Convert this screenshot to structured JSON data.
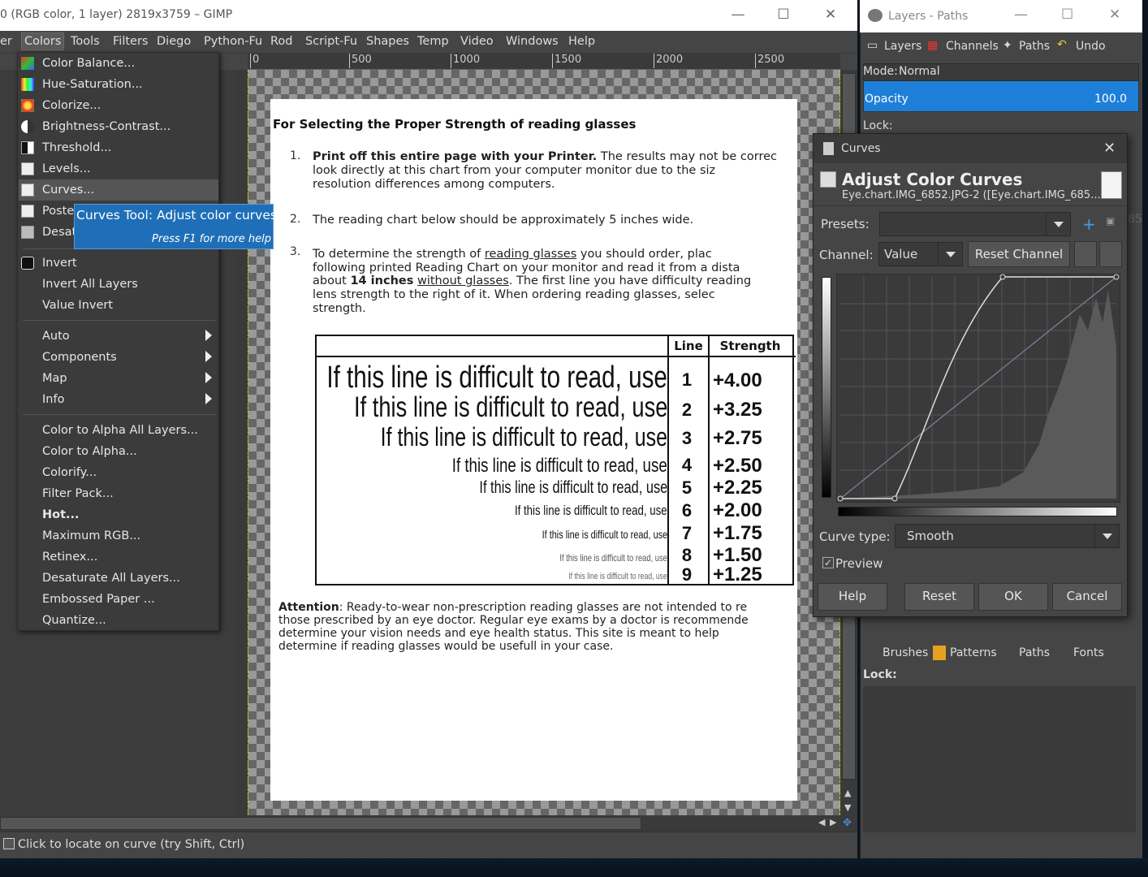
{
  "main_window": {
    "title": "0 (RGB color, 1 layer) 2819x3759 – GIMP",
    "menus": [
      "er",
      "Colors",
      "Tools",
      "Filters",
      "Diego",
      "Python-Fu",
      "Rod",
      "Script-Fu",
      "Shapes",
      "Temp",
      "Video",
      "Windows",
      "Help"
    ],
    "ruler_labels": [
      "0",
      "500",
      "1000",
      "1500",
      "2000",
      "2500"
    ],
    "status": "Click to locate on curve (try Shift, Ctrl)"
  },
  "colors_menu": {
    "items": [
      {
        "label": "Color Balance...",
        "icon": "color-balance-icon"
      },
      {
        "label": "Hue-Saturation...",
        "icon": "hue-saturation-icon"
      },
      {
        "label": "Colorize...",
        "icon": "colorize-icon"
      },
      {
        "label": "Brightness-Contrast...",
        "icon": "brightness-contrast-icon"
      },
      {
        "label": "Threshold...",
        "icon": "threshold-icon"
      },
      {
        "label": "Levels...",
        "icon": "levels-icon"
      },
      {
        "label": "Curves...",
        "icon": "curves-icon"
      },
      {
        "label": "Poster",
        "icon": "posterize-icon"
      },
      {
        "label": "Desat",
        "icon": "desaturate-icon"
      }
    ],
    "group2": [
      {
        "label": "Invert",
        "icon": "invert-icon"
      },
      {
        "label": "Invert All Layers"
      },
      {
        "label": "Value Invert"
      }
    ],
    "submenus": [
      "Auto",
      "Components",
      "Map",
      "Info"
    ],
    "group4": [
      "Color to Alpha All Layers...",
      "Color to Alpha...",
      "Colorify...",
      "Filter Pack...",
      "Hot...",
      "Maximum RGB...",
      "Retinex...",
      "Desaturate All Layers...",
      "Embossed Paper ...",
      "Quantize..."
    ]
  },
  "tooltip": {
    "title": "Curves Tool: Adjust color curves",
    "hint": "Press F1 for more help"
  },
  "document": {
    "heading": "For Selecting the Proper Strength of reading glasses",
    "p1_num": "1.",
    "p1_bold": "Print off this entire page with your Printer.",
    "p1_rest": " The results may not be correc",
    "p1_l2": "look directly at this chart from your computer monitor due to the siz",
    "p1_l3": "resolution differences among computers.",
    "p2_num": "2.",
    "p2": "The reading chart below should be approximately 5 inches wide.",
    "p3_num": "3.",
    "p3_l1a": "To determine the strength of ",
    "p3_l1u": "reading glasses",
    "p3_l1b": " you should order, plac",
    "p3_l2": "following printed Reading Chart on your monitor and read it from a dista",
    "p3_l3a": "about ",
    "p3_l3b": "14 inches",
    "p3_l3c": " ",
    "p3_l3u": "without glasses",
    ". ": "",
    "p3_l3d": ". The first line you have difficulty reading",
    "p3_l4": "lens strength to the right of it. When ordering reading glasses, selec",
    "p3_l5": "strength.",
    "chart_header": {
      "line": "Line",
      "strength": "Strength"
    },
    "rows": [
      {
        "text": "If this line is difficult to read, use",
        "line": "1",
        "strength": "+4.00"
      },
      {
        "text": "If this line is difficult to read, use",
        "line": "2",
        "strength": "+3.25"
      },
      {
        "text": "If this line is difficult to read, use",
        "line": "3",
        "strength": "+2.75"
      },
      {
        "text": "If this line is difficult to read, use",
        "line": "4",
        "strength": "+2.50"
      },
      {
        "text": "If this line is difficult to read, use",
        "line": "5",
        "strength": "+2.25"
      },
      {
        "text": "If this line is difficult to read, use",
        "line": "6",
        "strength": "+2.00"
      },
      {
        "text": "If this line is difficult to read, use",
        "line": "7",
        "strength": "+1.75"
      },
      {
        "text": "If this line is difficult to read, use",
        "line": "8",
        "strength": "+1.50"
      },
      {
        "text": "If this line is difficult to read, use",
        "line": "9",
        "strength": "+1.25"
      }
    ],
    "attention_bold": "Attention",
    "att_l1": ": Ready-to-wear non-prescription reading glasses are not intended to re",
    "att_l2": "those prescribed by an eye doctor. Regular eye exams by a doctor is recommende",
    "att_l3": "determine your vision needs and eye health status. This site is meant to help",
    "att_l4": "determine if reading glasses would be usefull in your case."
  },
  "dock": {
    "title": "Layers - Paths",
    "tabs": [
      "Layers",
      "Channels",
      "Paths",
      "Undo"
    ],
    "mode_label": "Mode:",
    "mode_value": "Normal",
    "opacity_label": "Opacity",
    "opacity_value": "100.0",
    "lock_label": "Lock:",
    "bottom_tabs": [
      "Brushes",
      "Patterns",
      "Paths",
      "Fonts"
    ],
    "lock2": "Lock:",
    "edge_number": "85"
  },
  "curves_dialog": {
    "window_title": "Curves",
    "heading": "Adjust Color Curves",
    "subheading": "Eye.chart.IMG_6852.JPG-2 ([Eye.chart.IMG_685...",
    "presets_label": "Presets:",
    "channel_label": "Channel:",
    "channel_value": "Value",
    "reset_channel": "Reset Channel",
    "curve_type_label": "Curve type:",
    "curve_type_value": "Smooth",
    "preview_label": "Preview",
    "preview_checked": true,
    "buttons": {
      "help": "Help",
      "reset": "Reset",
      "ok": "OK",
      "cancel": "Cancel"
    }
  }
}
